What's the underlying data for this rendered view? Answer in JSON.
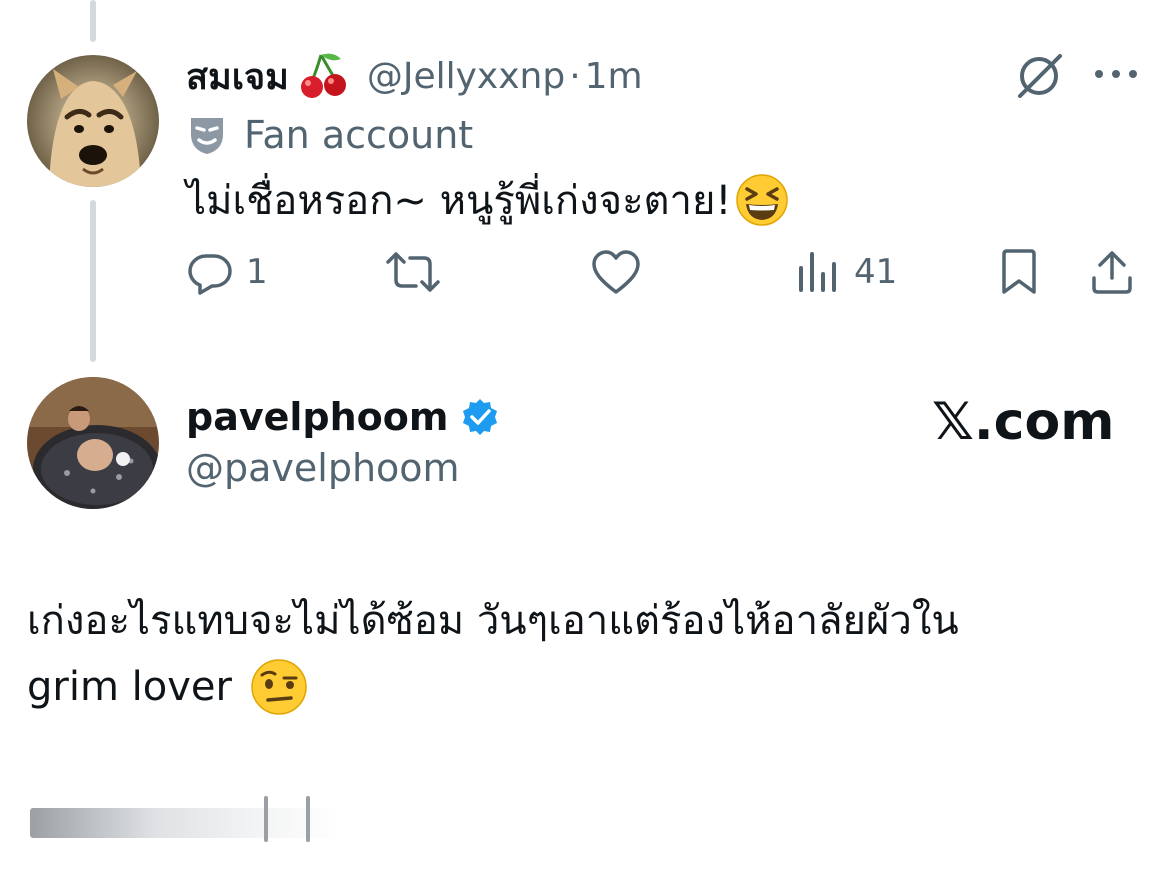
{
  "reply": {
    "display_name": "สมเจม",
    "handle": "@Jellyxxnp",
    "separator": "·",
    "time": "1m",
    "badge_label": "Fan account",
    "text": "ไม่เชื่อหรอก~ หนูรู้พี่เก่งจะตาย!",
    "stats": {
      "replies": "1",
      "views": "41"
    },
    "icons": [
      "cherries-icon",
      "grok-icon",
      "more-icon",
      "mask-icon",
      "reply-icon",
      "retweet-icon",
      "like-icon",
      "views-icon",
      "bookmark-icon",
      "share-icon",
      "grinning-squinting-emoji"
    ]
  },
  "original": {
    "display_name": "pavelphoom",
    "handle": "@pavelphoom",
    "site_label": "𝕏.com",
    "text_line1": "เก่งอะไรแทบจะไม่ได้ซ้อม วันๆเอาแต่ร้องไห้อาลัยผัวใน",
    "text_line2": "grim lover",
    "icons": [
      "verified-badge-icon",
      "raised-eyebrow-emoji"
    ]
  },
  "colors": {
    "text": "#0f1419",
    "muted": "#536471",
    "verified": "#1d9bf0",
    "thread_line": "#d3d9df"
  }
}
